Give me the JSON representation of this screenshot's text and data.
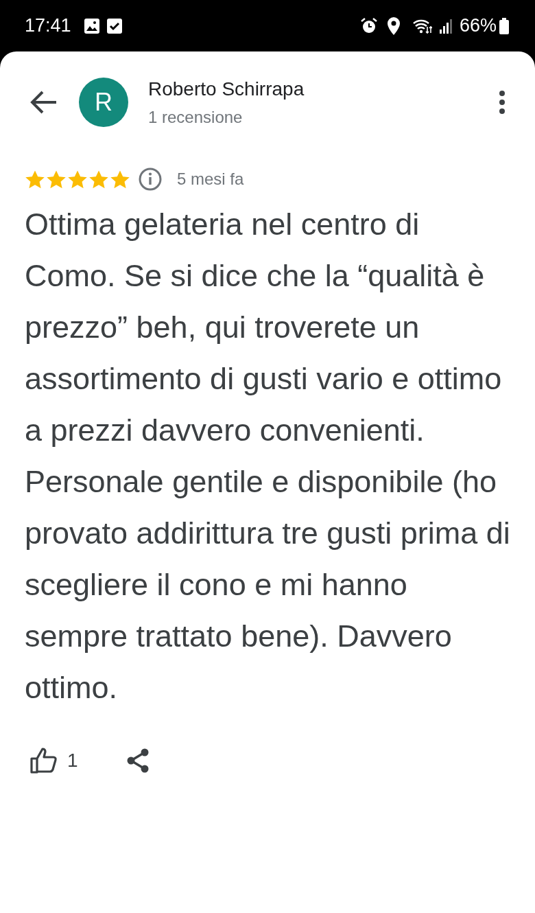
{
  "status_bar": {
    "time": "17:41",
    "battery": "66%"
  },
  "reviewer": {
    "initial": "R",
    "name": "Roberto Schirrapa",
    "review_count": "1 recensione"
  },
  "review": {
    "stars": 5,
    "date": "5 mesi fa",
    "text": "Ottima gelateria nel centro di Como. Se si dice che la “qualità è prezzo” beh, qui troverete un assortimento di gusti vario e ottimo a prezzi davvero convenienti. Personale gentile e disponibile (ho provato addirittura tre gusti prima di scegliere il cono e mi hanno sempre trattato bene). Davvero ottimo."
  },
  "actions": {
    "like_count": "1"
  }
}
